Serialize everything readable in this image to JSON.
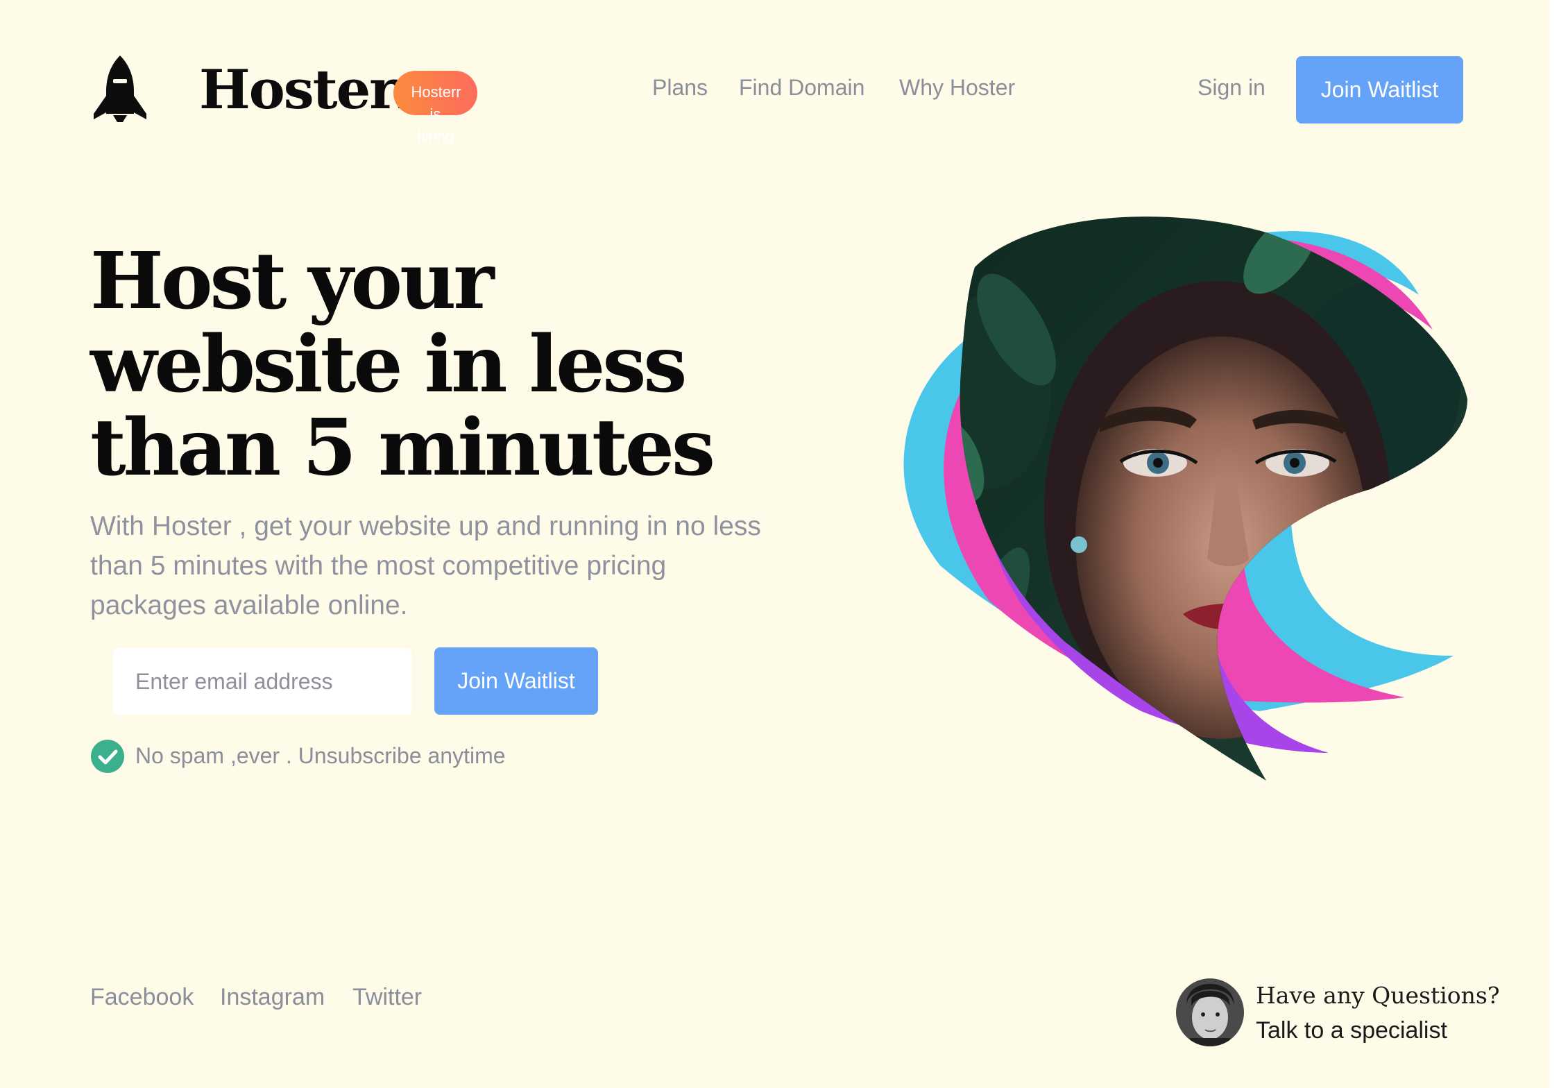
{
  "header": {
    "brand": "Hosterr",
    "hiring_badge": "Hosterr is hiring",
    "nav": [
      "Plans",
      "Find Domain",
      "Why Hoster"
    ],
    "sign_in": "Sign in",
    "join_waitlist": "Join Waitlist"
  },
  "hero": {
    "title": "Host your website in less than 5 minutes",
    "subtitle": "With Hoster , get your website up and running in no less than 5 minutes with the most competitive pricing packages available online.",
    "email_placeholder": "Enter email address",
    "join_waitlist": "Join Waitlist",
    "note": "No spam ,ever . Unsubscribe anytime"
  },
  "footer": {
    "social": [
      "Facebook",
      "Instagram",
      "Twitter"
    ],
    "question": "Have any Questions?",
    "specialist_link": "Talk to a specialist"
  },
  "icons": {
    "logo": "rocket-icon",
    "note": "check-circle-icon"
  },
  "colors": {
    "background": "#fefbe9",
    "primary_button": "#64a3f8",
    "badge_gradient": [
      "#fb8b3f",
      "#fd6c5d"
    ],
    "check": "#3cb08d",
    "ribbons": [
      "#4ac6ea",
      "#ed47b3",
      "#a745e8"
    ]
  }
}
